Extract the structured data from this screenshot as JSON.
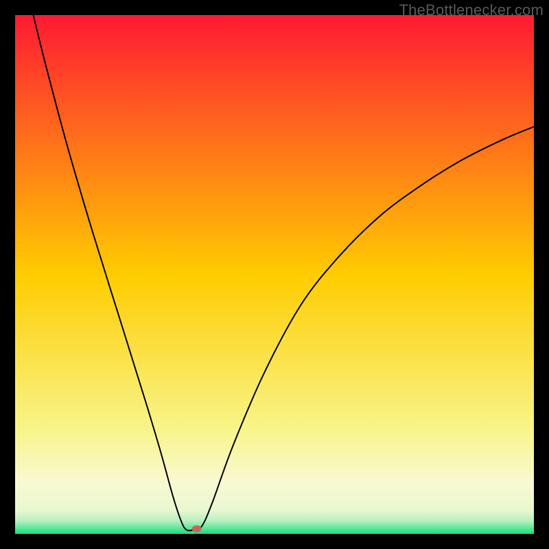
{
  "watermark": "TheBottlenecker.com",
  "chart_data": {
    "type": "line",
    "title": "",
    "xlabel": "",
    "ylabel": "",
    "xlim": [
      0,
      100
    ],
    "ylim": [
      0,
      100
    ],
    "legend": false,
    "grid": false,
    "background_gradient": {
      "stops": [
        {
          "pos": 0.0,
          "color": "#ff1a33"
        },
        {
          "pos": 0.5,
          "color": "#ffcc00"
        },
        {
          "pos": 0.8,
          "color": "#f7f58a"
        },
        {
          "pos": 0.9,
          "color": "#f9f9d2"
        },
        {
          "pos": 0.955,
          "color": "#e8f8d0"
        },
        {
          "pos": 0.975,
          "color": "#b8efc0"
        },
        {
          "pos": 1.0,
          "color": "#13e07e"
        }
      ]
    },
    "series": [
      {
        "name": "bottleneck-curve",
        "color": "#000000",
        "width": 2,
        "points": [
          {
            "x": 3.5,
            "y": 100.0
          },
          {
            "x": 6.0,
            "y": 90.0
          },
          {
            "x": 10.0,
            "y": 75.0
          },
          {
            "x": 15.0,
            "y": 58.0
          },
          {
            "x": 20.0,
            "y": 42.0
          },
          {
            "x": 25.0,
            "y": 26.0
          },
          {
            "x": 28.0,
            "y": 16.0
          },
          {
            "x": 30.5,
            "y": 7.0
          },
          {
            "x": 32.0,
            "y": 2.5
          },
          {
            "x": 33.0,
            "y": 0.8
          },
          {
            "x": 34.5,
            "y": 0.8
          },
          {
            "x": 36.0,
            "y": 1.5
          },
          {
            "x": 38.0,
            "y": 6.0
          },
          {
            "x": 42.0,
            "y": 17.0
          },
          {
            "x": 48.0,
            "y": 31.0
          },
          {
            "x": 55.0,
            "y": 44.0
          },
          {
            "x": 62.0,
            "y": 53.0
          },
          {
            "x": 70.0,
            "y": 61.0
          },
          {
            "x": 78.0,
            "y": 67.0
          },
          {
            "x": 86.0,
            "y": 72.0
          },
          {
            "x": 94.0,
            "y": 76.0
          },
          {
            "x": 100.0,
            "y": 78.5
          }
        ]
      }
    ],
    "marker": {
      "x": 35.0,
      "y": 1.0,
      "color": "#c9645c",
      "rx": 7,
      "ry": 5
    }
  }
}
